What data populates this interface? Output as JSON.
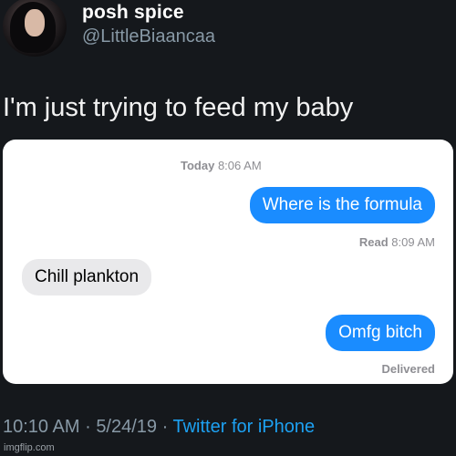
{
  "profile": {
    "display_name": "posh spice",
    "handle": "@LittleBiaancaa"
  },
  "tweet": {
    "text": "I'm just trying to feed my baby"
  },
  "conversation": {
    "header_timestamp": {
      "day": "Today",
      "time": "8:06 AM"
    },
    "messages": [
      {
        "direction": "outgoing",
        "text": "Where is the formula"
      },
      {
        "direction": "incoming",
        "text": "Chill plankton"
      },
      {
        "direction": "outgoing",
        "text": "Omfg bitch"
      }
    ],
    "read_receipt": {
      "label": "Read",
      "time": "8:09 AM"
    },
    "delivered_label": "Delivered"
  },
  "meta": {
    "time": "10:10 AM",
    "separator": "·",
    "date": "5/24/19",
    "source": "Twitter for iPhone"
  },
  "watermark": "imgflip.com",
  "colors": {
    "background": "#15181c",
    "outgoing_bubble": "#1a8cff",
    "incoming_bubble": "#e9e9eb",
    "link": "#1da1f2",
    "muted": "#8899a6"
  }
}
